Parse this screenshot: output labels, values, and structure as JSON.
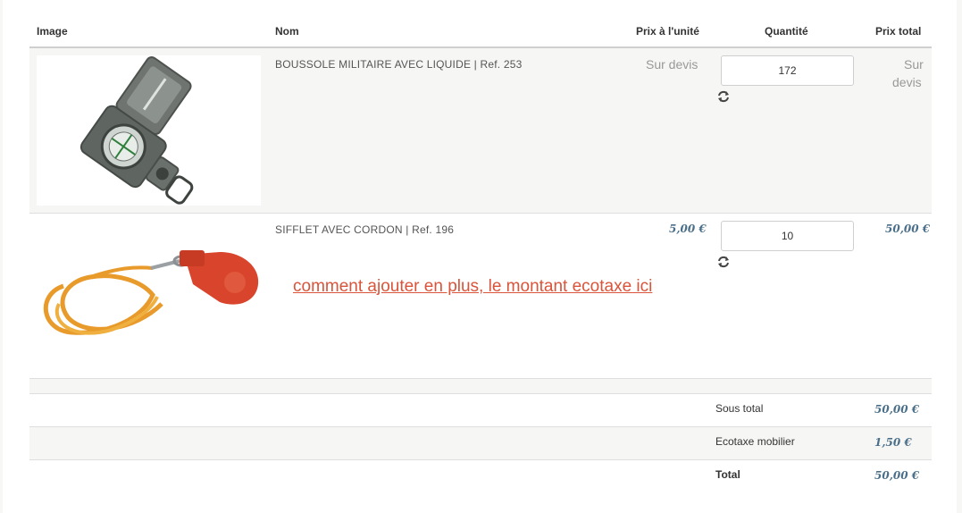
{
  "table": {
    "headers": {
      "image": "Image",
      "name": "Nom",
      "unit_price": "Prix à l'unité",
      "quantity": "Quantité",
      "total_price": "Prix total"
    },
    "rows": [
      {
        "name": "BOUSSOLE MILITAIRE AVEC LIQUIDE | Ref. 253",
        "unit_price": "Sur devis",
        "quantity": "172",
        "total_price_line1": "Sur",
        "total_price_line2": "devis",
        "image_icon": "compass-icon"
      },
      {
        "name": "SIFFLET AVEC CORDON | Ref. 196",
        "unit_price": "5,00 €",
        "quantity": "10",
        "total_price": "50,00 €",
        "image_icon": "whistle-icon"
      }
    ]
  },
  "annotation": "comment ajouter en plus, le montant ecotaxe ici",
  "totals": [
    {
      "label": "Sous total",
      "value": "50,00 €"
    },
    {
      "label": "Ecotaxe mobilier",
      "value": "1,50 €"
    },
    {
      "label": "Total",
      "value": "50,00 €"
    }
  ],
  "icons": {
    "refresh": "refresh-icon"
  },
  "colors": {
    "annotation": "#d9543a",
    "price": "#4a6f8a"
  }
}
